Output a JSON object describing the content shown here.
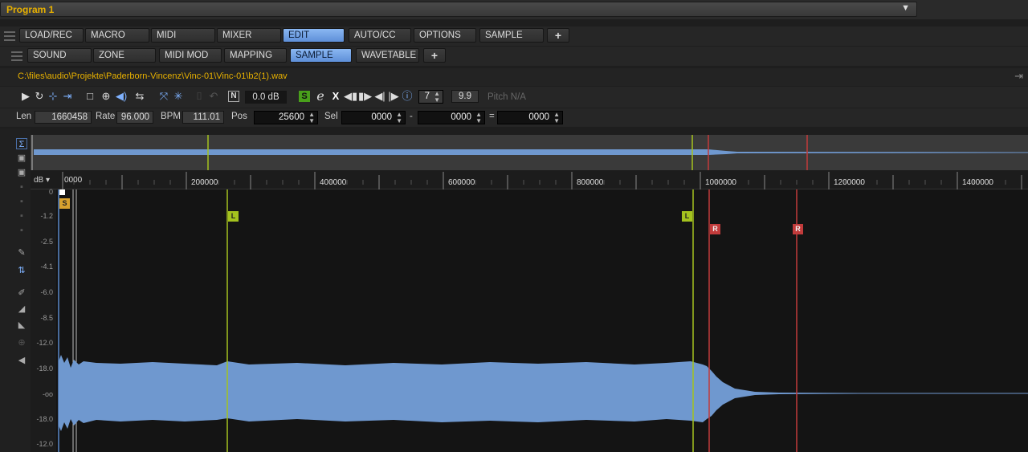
{
  "program": {
    "title": "Program 1"
  },
  "tabs_row1": [
    "LOAD/REC",
    "MACRO",
    "MIDI",
    "MIXER",
    "EDIT",
    "AUTO/CC",
    "OPTIONS",
    "SAMPLE",
    "+"
  ],
  "tabs_row1_active": "EDIT",
  "tabs_row2": [
    "SOUND",
    "ZONE",
    "MIDI MOD",
    "MAPPING",
    "SAMPLE",
    "WAVETABLE",
    "+"
  ],
  "tabs_row2_active": "SAMPLE",
  "file_path": "C:\\files\\audio\\Projekte\\Paderborn-Vincenz\\Vinc-01\\Vinc-01\\b2(1).wav",
  "toolbar": {
    "gain": "0.0 dB",
    "n_label": "N",
    "s_label": "S",
    "e_label": "e",
    "x_label": "X",
    "crossfade": "7",
    "value": "9.9",
    "pitch": "Pitch  N/A"
  },
  "info": {
    "len_label": "Len",
    "len": "1660458",
    "rate_label": "Rate",
    "rate": "96.000",
    "bpm_label": "BPM",
    "bpm": "111.01",
    "pos_label": "Pos",
    "pos": "25600",
    "sel_label": "Sel",
    "sel_start": "0000",
    "dash": "-",
    "sel_end": "0000",
    "eq": "=",
    "sel_len": "0000"
  },
  "ruler": {
    "unit": "dB",
    "ticks": [
      "0000",
      "200000",
      "400000",
      "600000",
      "800000",
      "1000000",
      "1200000",
      "1400000"
    ]
  },
  "db_scale": [
    "0",
    "-1.2",
    "-2.5",
    "-4.1",
    "-6.0",
    "-8.5",
    "-12.0",
    "-18.0",
    "-oo",
    "-18.0",
    "-12.0"
  ],
  "markers": {
    "start": "S",
    "loop_start": "L",
    "loop_end": "L",
    "release": "R",
    "release2": "R"
  },
  "colors": {
    "accent": "#e8b100",
    "waveform": "#6f98cf",
    "loop": "#a4c21e",
    "release": "#c23b3b",
    "active_tab": "#7aa9ec"
  }
}
